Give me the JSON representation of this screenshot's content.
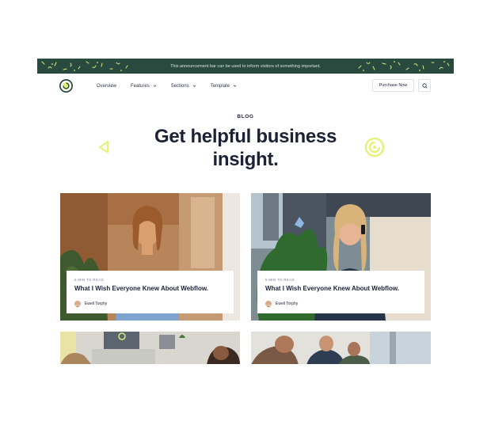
{
  "announcement": {
    "message": "This announcement bar can be used to inform visitors of something important."
  },
  "nav": {
    "links": [
      {
        "label": "Overview",
        "has_dropdown": false
      },
      {
        "label": "Features",
        "has_dropdown": true
      },
      {
        "label": "Sections",
        "has_dropdown": true
      },
      {
        "label": "Template",
        "has_dropdown": true
      }
    ],
    "purchase_label": "Purchase Now"
  },
  "hero": {
    "eyebrow": "BLOG",
    "title_line1": "Get helpful business",
    "title_line2": "insight."
  },
  "posts": [
    {
      "read_time": "5 MIN TO READ",
      "title": "What I Wish Everyone Knew About Webflow.",
      "author": "Ewell Torphy"
    },
    {
      "read_time": "5 MIN TO READ",
      "title": "What I Wish Everyone Knew About Webflow.",
      "author": "Ewell Torphy"
    }
  ],
  "colors": {
    "announcement_bg": "#2b4a3f",
    "accent_lime": "#e4f27a",
    "text_dark": "#1c2136"
  },
  "icons": [
    "logo-icon",
    "chevron-down-icon",
    "search-icon",
    "triangle-deco-icon",
    "swirl-deco-icon"
  ]
}
